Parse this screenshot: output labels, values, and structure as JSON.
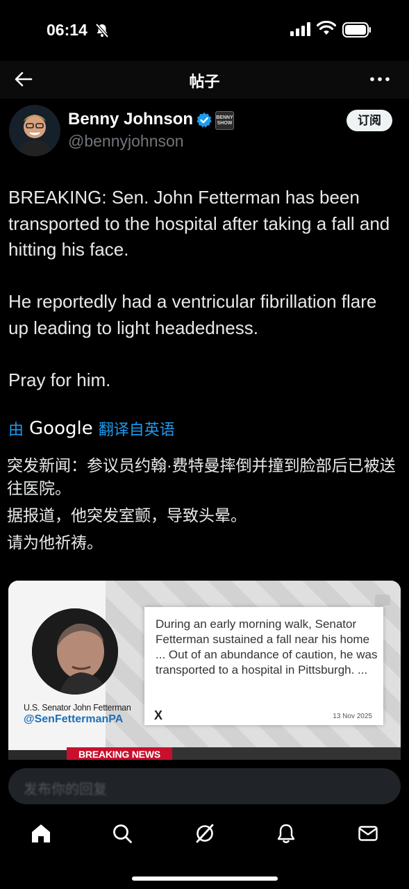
{
  "status_bar": {
    "time": "06:14"
  },
  "top_nav": {
    "title": "帖子"
  },
  "author": {
    "name": "Benny Johnson",
    "handle": "@bennyjohnson",
    "affiliate_badge": "BENNY SHOW",
    "subscribe_label": "订阅"
  },
  "post": {
    "paragraphs": [
      "BREAKING: Sen. John Fetterman has been transported to the hospital after taking a fall and hitting his face.",
      "He reportedly had a ventricular fibrillation flare up leading to light headedness.",
      "Pray for him."
    ]
  },
  "translation": {
    "prefix": "由",
    "provider": "Google",
    "suffix": "翻译自英语",
    "paragraphs": [
      "突发新闻：参议员约翰·费特曼摔倒并撞到脸部后已被送往医院。",
      "据报道，他突发室颤，导致头晕。",
      "请为他祈祷。"
    ]
  },
  "media": {
    "senator_label": "U.S. Senator John Fetterman",
    "senator_handle": "@SenFettermanPA",
    "quote": "During an early morning walk, Senator Fetterman sustained a fall near his home ... Out of an abundance of caution, he was transported to a hospital in Pittsburgh. ...",
    "quote_source": "X",
    "quote_date": "13 Nov 2025",
    "banner": "BREAKING NEWS"
  },
  "reply": {
    "placeholder": "发布你的回复"
  },
  "tabs": [
    "home-icon",
    "search-icon",
    "grok-icon",
    "notifications-icon",
    "messages-icon"
  ],
  "colors": {
    "accent": "#1d9bf0",
    "background": "#000000",
    "breaking": "#c8102e"
  }
}
